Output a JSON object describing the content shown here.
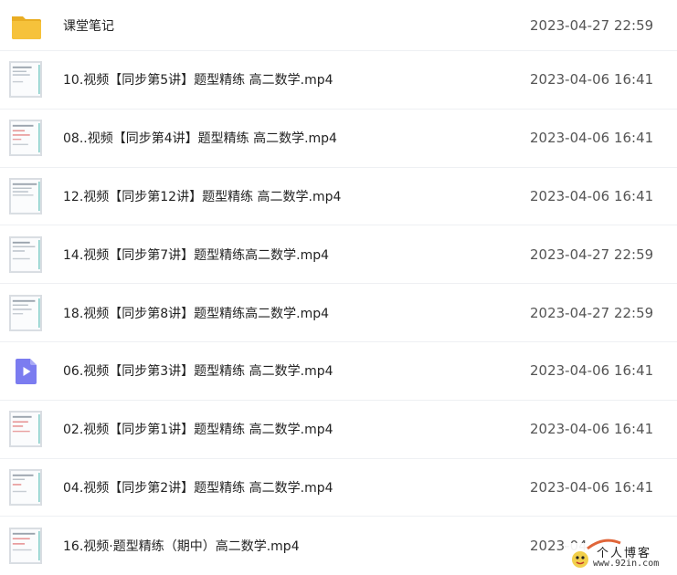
{
  "files": [
    {
      "name": "课堂笔记",
      "date": "2023-04-27 22:59",
      "icon": "folder-icon"
    },
    {
      "name": "10.视频【同步第5讲】题型精练 高二数学.mp4",
      "date": "2023-04-06 16:41",
      "icon": "video-thumbnail"
    },
    {
      "name": "08..视频【同步第4讲】题型精练 高二数学.mp4",
      "date": "2023-04-06 16:41",
      "icon": "video-thumbnail"
    },
    {
      "name": "12.视频【同步第12讲】题型精练 高二数学.mp4",
      "date": "2023-04-06 16:41",
      "icon": "video-thumbnail"
    },
    {
      "name": "14.视频【同步第7讲】题型精练高二数学.mp4",
      "date": "2023-04-27 22:59",
      "icon": "video-thumbnail"
    },
    {
      "name": "18.视频【同步第8讲】题型精练高二数学.mp4",
      "date": "2023-04-27 22:59",
      "icon": "video-thumbnail"
    },
    {
      "name": "06.视频【同步第3讲】题型精练 高二数学.mp4",
      "date": "2023-04-06 16:41",
      "icon": "video-file-icon"
    },
    {
      "name": "02.视频【同步第1讲】题型精练 高二数学.mp4",
      "date": "2023-04-06 16:41",
      "icon": "video-thumbnail"
    },
    {
      "name": "04.视频【同步第2讲】题型精练 高二数学.mp4",
      "date": "2023-04-06 16:41",
      "icon": "video-thumbnail"
    },
    {
      "name": "16.视频·题型精练（期中）高二数学.mp4",
      "date": "2023-04",
      "icon": "video-thumbnail"
    }
  ],
  "watermark": {
    "title": "个人博客",
    "url": "www.92in.com"
  },
  "colors": {
    "folder": "#f6c23b",
    "video_icon": "#7b7cf0",
    "text": "#222222",
    "date_text": "#555555",
    "divider": "#eef0f3"
  }
}
